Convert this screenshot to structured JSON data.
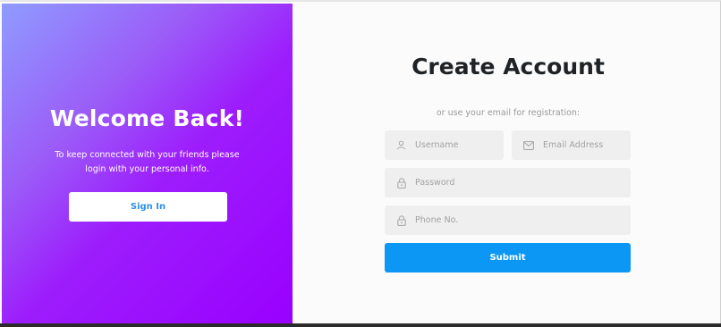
{
  "welcome": {
    "title": "Welcome Back!",
    "text": "To keep connected with your friends please login with your personal info.",
    "signin_label": "Sign In"
  },
  "register": {
    "title": "Create Account",
    "subtitle": "or use your email for registration:",
    "fields": {
      "username": {
        "placeholder": "Username",
        "icon": "user-icon"
      },
      "email": {
        "placeholder": "Email Address",
        "icon": "envelope-icon"
      },
      "password": {
        "placeholder": "Password",
        "icon": "lock-icon"
      },
      "phone": {
        "placeholder": "Phone No.",
        "icon": "lock-icon"
      }
    },
    "submit_label": "Submit"
  },
  "colors": {
    "gradient_start": "#8f9cff",
    "gradient_end": "#9900ff",
    "submit": "#0d97f5",
    "signin_text": "#2f8fe6",
    "field_bg": "#efefef"
  }
}
